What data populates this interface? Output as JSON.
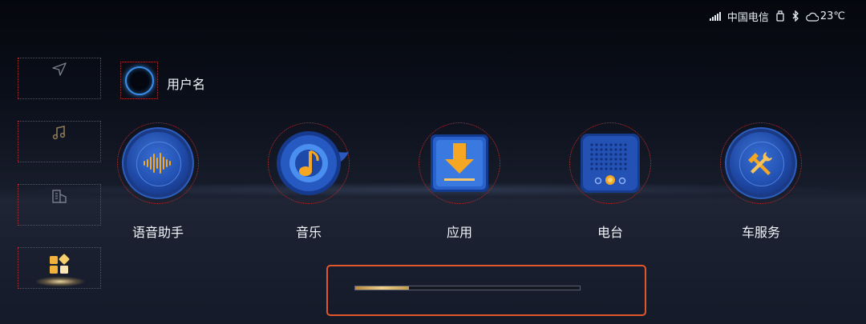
{
  "status_bar": {
    "carrier": "中国电信",
    "temperature": "23℃",
    "icons": [
      "signal-icon",
      "usb-icon",
      "bluetooth-icon",
      "cloudy-weather-icon"
    ]
  },
  "sidebar": {
    "items": [
      {
        "name": "navigation",
        "icon": "navigation-arrow-icon",
        "active": false
      },
      {
        "name": "music",
        "icon": "music-note-icon",
        "active": false
      },
      {
        "name": "building",
        "icon": "building-icon",
        "active": false
      },
      {
        "name": "apps",
        "icon": "app-grid-icon",
        "active": true
      }
    ]
  },
  "user": {
    "name": "用户名"
  },
  "apps": [
    {
      "label": "语音助手",
      "icon": "voice-wave-icon"
    },
    {
      "label": "音乐",
      "icon": "music-note-icon"
    },
    {
      "label": "应用",
      "icon": "download-icon"
    },
    {
      "label": "电台",
      "icon": "radio-icon"
    },
    {
      "label": "车服务",
      "icon": "tools-icon"
    }
  ],
  "pager": {
    "progress": 0.24
  },
  "colors": {
    "accent_orange": "#f5a623",
    "accent_blue": "#2453b8",
    "focus_border": "#e2562c"
  }
}
